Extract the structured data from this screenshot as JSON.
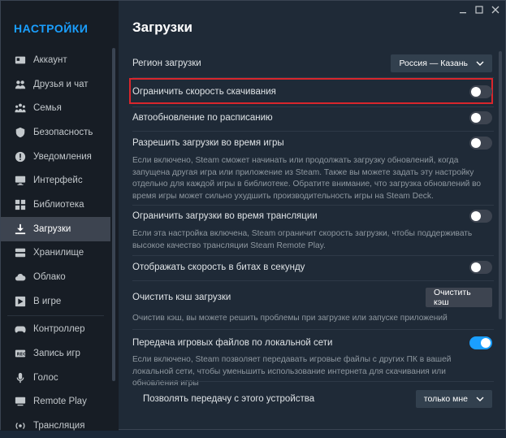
{
  "sidebar": {
    "title": "НАСТРОЙКИ",
    "items": [
      {
        "label": "Аккаунт",
        "icon": "account-card-icon"
      },
      {
        "label": "Друзья и чат",
        "icon": "friends-icon"
      },
      {
        "label": "Семья",
        "icon": "family-icon"
      },
      {
        "label": "Безопасность",
        "icon": "shield-icon"
      },
      {
        "label": "Уведомления",
        "icon": "alert-icon"
      },
      {
        "label": "Интерфейс",
        "icon": "monitor-icon"
      },
      {
        "label": "Библиотека",
        "icon": "library-grid-icon"
      },
      {
        "label": "Загрузки",
        "icon": "download-icon",
        "active": true
      },
      {
        "label": "Хранилище",
        "icon": "storage-icon"
      },
      {
        "label": "Облако",
        "icon": "cloud-icon"
      },
      {
        "label": "В игре",
        "icon": "ingame-icon"
      },
      {
        "label": "Контроллер",
        "icon": "controller-icon"
      },
      {
        "label": "Запись игр",
        "icon": "record-icon"
      },
      {
        "label": "Голос",
        "icon": "microphone-icon"
      },
      {
        "label": "Remote Play",
        "icon": "remote-play-icon"
      },
      {
        "label": "Трансляция",
        "icon": "broadcast-icon"
      }
    ]
  },
  "page": {
    "title": "Загрузки"
  },
  "settings": {
    "region": {
      "label": "Регион загрузки",
      "value": "Россия — Казань"
    },
    "limit_speed": {
      "label": "Ограничить скорость скачивания",
      "on": false
    },
    "auto_update": {
      "label": "Автообновление по расписанию",
      "on": false
    },
    "allow_during_game": {
      "label": "Разрешить загрузки во время игры",
      "on": false,
      "desc": "Если включено, Steam сможет начинать или продолжать загрузку обновлений, когда запущена другая игра или приложение из Steam. Также вы можете задать эту настройку отдельно для каждой игры в библиотеке. Обратите внимание, что загрузка обновлений во время игры может сильно ухудшить производительность игры на Steam Deck."
    },
    "limit_broadcast": {
      "label": "Ограничить загрузки во время трансляции",
      "on": false,
      "desc": "Если эта настройка включена, Steam ограничит скорость загрузки, чтобы поддерживать высокое качество трансляции Steam Remote Play."
    },
    "bits_speed": {
      "label": "Отображать скорость в битах в секунду",
      "on": false
    },
    "clear_cache": {
      "label": "Очистить кэш загрузки",
      "button": "Очистить кэш",
      "desc": "Очистив кэш, вы можете решить проблемы при загрузке или запуске приложений"
    },
    "lan_transfer": {
      "label": "Передача игровых файлов по локальной сети",
      "on": true,
      "desc": "Если включено, Steam позволяет передавать игровые файлы с других ПК в вашей локальной сети, чтобы уменьшить использование интернета для скачивания или обновления игры"
    },
    "allow_transfer_from": {
      "label": "Позволять передачу с этого устройства",
      "value": "только мне"
    }
  },
  "colors": {
    "accent": "#1a9fff",
    "highlight": "#d9262c"
  }
}
